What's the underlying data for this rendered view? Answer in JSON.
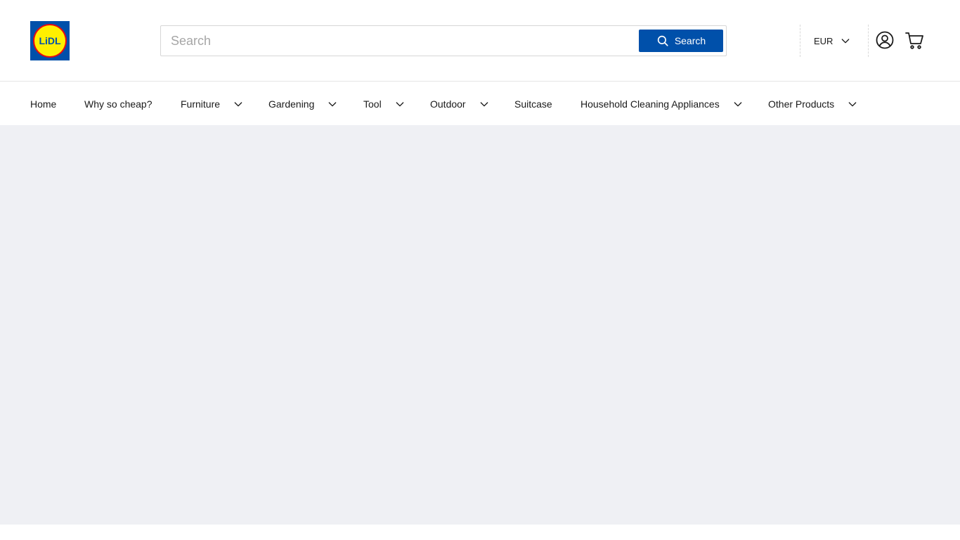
{
  "header": {
    "logo_text": "LiDL",
    "search": {
      "placeholder": "Search",
      "value": "",
      "button_label": "Search"
    },
    "currency": {
      "label": "EUR"
    }
  },
  "nav": {
    "items": [
      {
        "label": "Home",
        "has_dropdown": false
      },
      {
        "label": "Why so cheap?",
        "has_dropdown": false
      },
      {
        "label": "Furniture",
        "has_dropdown": true
      },
      {
        "label": "Gardening",
        "has_dropdown": true
      },
      {
        "label": "Tool",
        "has_dropdown": true
      },
      {
        "label": "Outdoor",
        "has_dropdown": true
      },
      {
        "label": "Suitcase",
        "has_dropdown": false
      },
      {
        "label": "Household Cleaning Appliances",
        "has_dropdown": true
      },
      {
        "label": "Other Products",
        "has_dropdown": true
      }
    ]
  },
  "colors": {
    "brand_blue": "#0050aa",
    "brand_yellow": "#fff000",
    "brand_red": "#e60a14",
    "content_bg": "#eff0f4"
  },
  "icons": {
    "search": "search-icon",
    "chevron": "chevron-down-icon",
    "account": "account-icon",
    "cart": "cart-icon"
  }
}
